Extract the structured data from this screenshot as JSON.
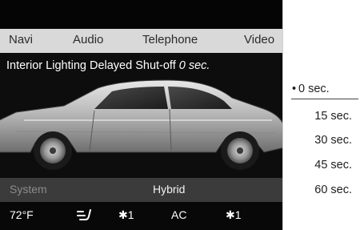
{
  "menu": {
    "items": [
      "Navi",
      "Audio",
      "Telephone",
      "Video"
    ]
  },
  "setting": {
    "label": "Interior Lighting Delayed Shut-off",
    "value": "0 sec."
  },
  "status": {
    "left": "System",
    "center": "Hybrid"
  },
  "climate": {
    "temperature": "72°F",
    "airflow_icon": "air-distribution-icon",
    "fan_left": "✱1",
    "ac": "AC",
    "fan_right": "✱1"
  },
  "options": {
    "selected_marker": "•",
    "items": [
      "0 sec.",
      "15 sec.",
      "30 sec.",
      "45 sec.",
      "60 sec."
    ]
  }
}
